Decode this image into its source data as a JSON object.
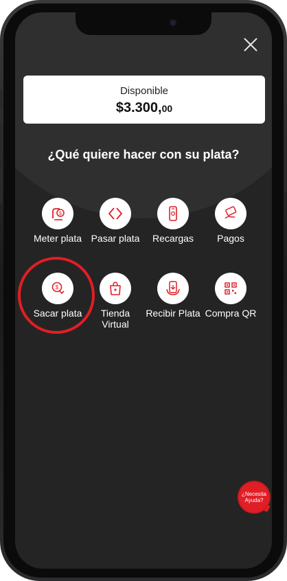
{
  "balance": {
    "label": "Disponible",
    "amount": "$3.300,",
    "cents": "00"
  },
  "prompt": "¿Qué quiere hacer con su plata?",
  "actions": [
    {
      "label": "Meter plata",
      "icon": "deposit-icon"
    },
    {
      "label": "Pasar plata",
      "icon": "transfer-icon"
    },
    {
      "label": "Recargas",
      "icon": "phone-topup-icon"
    },
    {
      "label": "Pagos",
      "icon": "payments-icon"
    },
    {
      "label": "Sacar plata",
      "icon": "withdraw-icon"
    },
    {
      "label": "Tienda Virtual",
      "icon": "shopping-bag-icon"
    },
    {
      "label": "Recibir Plata",
      "icon": "receive-money-icon"
    },
    {
      "label": "Compra QR",
      "icon": "qr-code-icon"
    }
  ],
  "help": {
    "label": "¿Necesita Ayuda?"
  },
  "colors": {
    "accent": "#e01e26",
    "background": "#242424",
    "card": "#ffffff"
  }
}
